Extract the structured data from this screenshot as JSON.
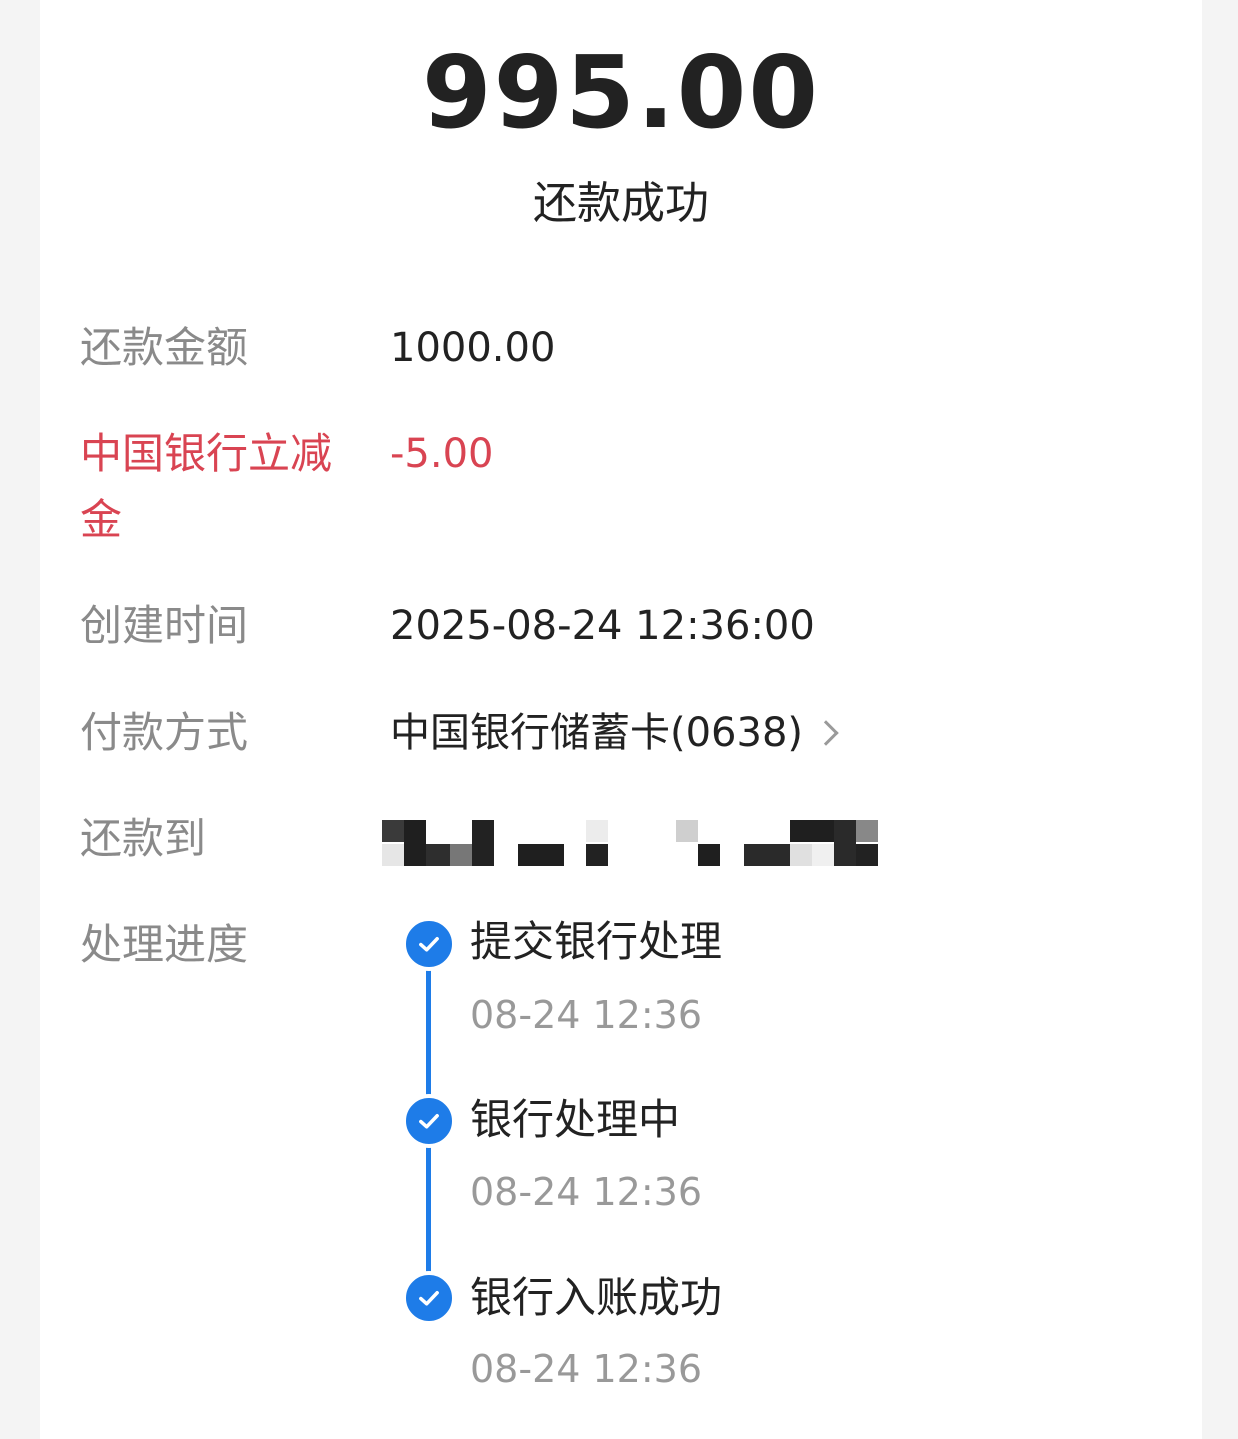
{
  "header": {
    "amount": "995.00",
    "status": "还款成功"
  },
  "details": {
    "repay_amount_label": "还款金额",
    "repay_amount_value": "1000.00",
    "discount_label_line1": "中国银行立减",
    "discount_label_line2": "金",
    "discount_value": "-5.00",
    "created_label": "创建时间",
    "created_value": "2025-08-24 12:36:00",
    "payment_label": "付款方式",
    "payment_value": "中国银行储蓄卡(0638)",
    "repay_to_label": "还款到",
    "progress_label": "处理进度"
  },
  "progress": [
    {
      "title": "提交银行处理",
      "time": "08-24 12:36"
    },
    {
      "title": "银行处理中",
      "time": "08-24 12:36"
    },
    {
      "title": "银行入账成功",
      "time": "08-24 12:36"
    }
  ],
  "colors": {
    "accent": "#1e7ce8",
    "discount": "#d94452"
  }
}
